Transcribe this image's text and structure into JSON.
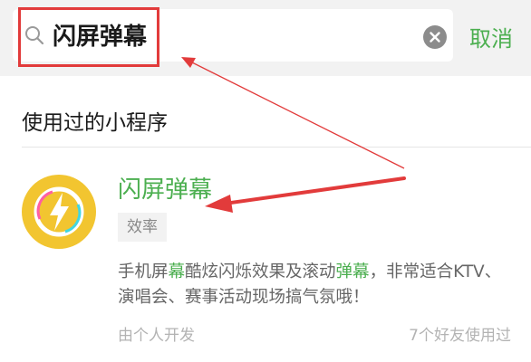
{
  "search": {
    "query": "闪屏弹幕",
    "cancel_label": "取消"
  },
  "section": {
    "title": "使用过的小程序"
  },
  "app": {
    "name": "闪屏弹幕",
    "category": "效率",
    "desc": {
      "p1": "手机屏",
      "h1": "幕",
      "p2": "酷炫闪烁效果及滚动",
      "h2": "弹幕",
      "p3": "，非常适合KTV、演唱会、赛事活动现场搞气氛哦！"
    },
    "developer": "由个人开发",
    "friends_used": "7个好友使用过",
    "icon": "lightning-bolt-icon"
  },
  "colors": {
    "accent_green": "#4caf50",
    "annotation_red": "#e23b3b",
    "icon_yellow": "#f2c530"
  }
}
